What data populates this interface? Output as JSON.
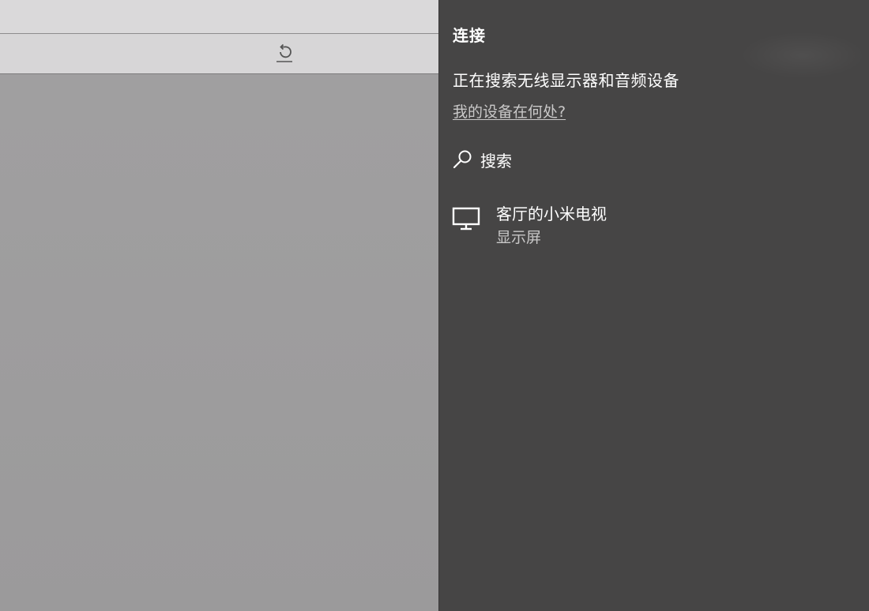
{
  "background_window": {
    "refresh_icon": "refresh-icon"
  },
  "connect_pane": {
    "title": "连接",
    "status_text": "正在搜索无线显示器和音频设备",
    "help_link": "我的设备在何处?",
    "search": {
      "icon": "search-icon",
      "label": "搜索"
    },
    "devices": [
      {
        "icon": "monitor-icon",
        "name": "客厅的小米电视",
        "type": "显示屏"
      }
    ],
    "colors": {
      "pane_bg": "#464545",
      "text_primary": "#ffffff",
      "text_secondary": "#c8c7c7"
    }
  }
}
